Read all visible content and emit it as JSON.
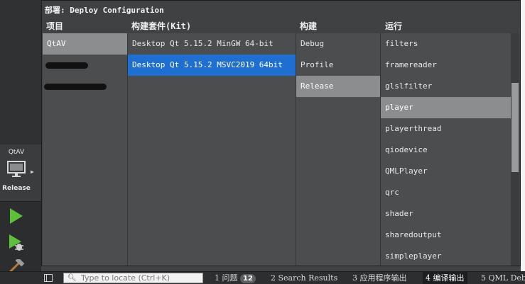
{
  "popup": {
    "title": "部署: Deploy Configuration",
    "headers": {
      "project": "项目",
      "kit": "构建套件(Kit)",
      "build": "构建",
      "run": "运行"
    },
    "projects": [
      {
        "label": "QtAV",
        "selected": true
      },
      {
        "label": "",
        "redacted": true
      },
      {
        "label": "",
        "redacted": true
      }
    ],
    "kits": [
      {
        "label": "Desktop Qt 5.15.2 MinGW 64-bit",
        "selected": false
      },
      {
        "label": "Desktop Qt 5.15.2 MSVC2019 64bit",
        "selected": true
      }
    ],
    "builds": [
      {
        "label": "Debug",
        "selected": false
      },
      {
        "label": "Profile",
        "selected": false
      },
      {
        "label": "Release",
        "selected": true
      }
    ],
    "runs": [
      {
        "label": "filters"
      },
      {
        "label": "framereader"
      },
      {
        "label": "glslfilter"
      },
      {
        "label": "player",
        "selected": true
      },
      {
        "label": "playerthread"
      },
      {
        "label": "qiodevice"
      },
      {
        "label": "QMLPlayer"
      },
      {
        "label": "qrc"
      },
      {
        "label": "shader"
      },
      {
        "label": "sharedoutput"
      },
      {
        "label": "simpleplayer"
      }
    ]
  },
  "sidebar": {
    "project_name": "QtAV",
    "build_config": "Release",
    "icons": [
      "monitor-icon",
      "run-icon",
      "debug-run-icon",
      "build-hammer-icon"
    ]
  },
  "bottombar": {
    "locator_placeholder": "Type to locate (Ctrl+K)",
    "tabs": [
      {
        "number": "1",
        "label": "问题",
        "badge": "12"
      },
      {
        "number": "2",
        "label": "Search Results"
      },
      {
        "number": "3",
        "label": "应用程序输出"
      },
      {
        "number": "4",
        "label": "编译输出",
        "active": true
      },
      {
        "number": "5",
        "label": "QML Debu"
      }
    ]
  },
  "colors": {
    "selection_blue": "#1e6fd1",
    "selection_grey": "#8c8d8e",
    "run_green": "#5fbf3a"
  }
}
